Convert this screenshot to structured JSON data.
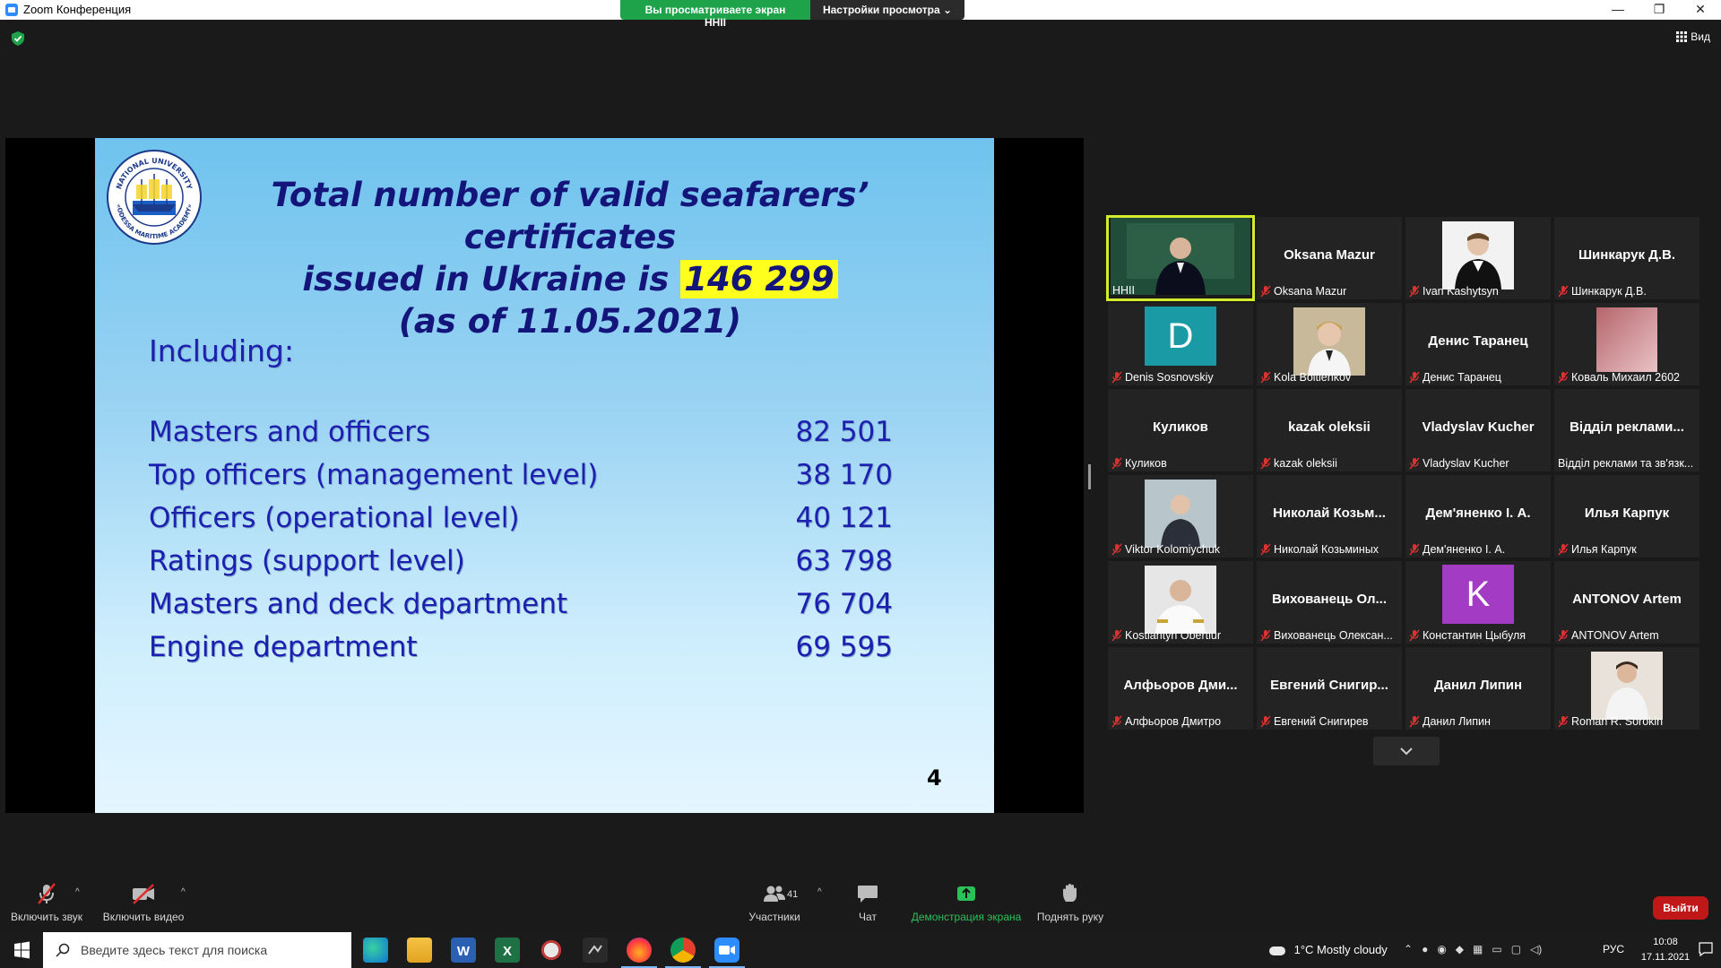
{
  "window": {
    "title": "Zoom Конференция",
    "viewing_banner": "Вы просматриваете экран HHII",
    "view_options": "Настройки просмотра ⌄",
    "controls": [
      "—",
      "❐",
      "✕"
    ],
    "view_button": "Вид"
  },
  "slide": {
    "title_line1": "Total number of valid seafarers’ certificates",
    "title_line2_prefix": "issued in Ukraine is ",
    "title_highlight": "146 299",
    "title_line3": "(as of 11.05.2021)",
    "including": "Including:",
    "rows": [
      {
        "label": "Masters and officers",
        "value": "82 501"
      },
      {
        "label": "Top officers (management level)",
        "value": "38 170"
      },
      {
        "label": "Officers (operational level)",
        "value": "40 121"
      },
      {
        "label": "Ratings (support level)",
        "value": "63 798"
      },
      {
        "label": "Masters and deck department",
        "value": "76 704"
      },
      {
        "label": "Engine department",
        "value": "69 595"
      }
    ],
    "page_number": "4",
    "logo_text_top": "NATIONAL UNIVERSITY",
    "logo_text_bottom": "«ODESSA MARITIME ACADEMY»"
  },
  "participants": [
    {
      "name": "HHII",
      "display": "",
      "kind": "video-man",
      "active": true,
      "muted": false
    },
    {
      "name": "Oksana Mazur",
      "display": "Oksana Mazur",
      "kind": "name",
      "muted": true
    },
    {
      "name": "Ivan Kashytsyn",
      "display": "",
      "kind": "photo-uniform",
      "muted": true
    },
    {
      "name": "Шинкарук Д.В.",
      "display": "Шинкарук Д.В.",
      "kind": "name",
      "muted": true
    },
    {
      "name": "Denis Sosnovskiy",
      "display": "",
      "kind": "letter",
      "letter": "D",
      "color": "#1a9aa5",
      "muted": true
    },
    {
      "name": "Kola Boltienkov",
      "display": "",
      "kind": "photo-young",
      "muted": true
    },
    {
      "name": "Денис Таранец",
      "display": "Денис Таранец",
      "kind": "name",
      "muted": true
    },
    {
      "name": "Коваль Михаил 2602",
      "display": "",
      "kind": "photo-pink",
      "muted": true
    },
    {
      "name": "Куликов",
      "display": "Куликов",
      "kind": "name",
      "muted": true
    },
    {
      "name": "kazak oleksii",
      "display": "kazak oleksii",
      "kind": "name",
      "muted": true
    },
    {
      "name": "Vladyslav Kucher",
      "display": "Vladyslav Kucher",
      "kind": "name",
      "muted": true
    },
    {
      "name": "Відділ реклами та зв'язк...",
      "display": "Відділ реклами...",
      "kind": "name",
      "muted": false
    },
    {
      "name": "Viktor Kolomiychuk",
      "display": "",
      "kind": "photo-man",
      "muted": true
    },
    {
      "name": "Николай Козьминых",
      "display": "Николай Козьм...",
      "kind": "name",
      "muted": true
    },
    {
      "name": "Дем'яненко І. А.",
      "display": "Дем'яненко І. А.",
      "kind": "name",
      "muted": true
    },
    {
      "name": "Илья Карпук",
      "display": "Илья Карпук",
      "kind": "name",
      "muted": true
    },
    {
      "name": "Kostiantyn Obertiur",
      "display": "",
      "kind": "photo-officer",
      "muted": true
    },
    {
      "name": "Вихованець Олексан...",
      "display": "Вихованець Ол...",
      "kind": "name",
      "muted": true
    },
    {
      "name": "Константин Цыбуля",
      "display": "",
      "kind": "letter",
      "letter": "K",
      "color": "#a33bc5",
      "muted": true
    },
    {
      "name": "ANTONOV Artem",
      "display": "ANTONOV Artem",
      "kind": "name",
      "muted": true
    },
    {
      "name": "Алфьоров Дмитро",
      "display": "Алфьоров Дми...",
      "kind": "name",
      "muted": true
    },
    {
      "name": "Евгений Снигирев",
      "display": "Евгений Снигир...",
      "kind": "name",
      "muted": true
    },
    {
      "name": "Данил Липин",
      "display": "Данил Липин",
      "kind": "name",
      "muted": true
    },
    {
      "name": "Roman R. Sorokin",
      "display": "",
      "kind": "photo-roman",
      "muted": true
    }
  ],
  "toolbar": {
    "mute": "Включить звук",
    "video": "Включить видео",
    "participants": "Участники",
    "participants_count": "41",
    "chat": "Чат",
    "share": "Демонстрация экрана",
    "raise_hand": "Поднять руку",
    "leave": "Выйти",
    "caret": "^"
  },
  "taskbar": {
    "search_placeholder": "Введите здесь текст для поиска",
    "weather": "1°C  Mostly cloudy",
    "language": "РУС",
    "time": "10:08",
    "date": "17.11.2021"
  }
}
